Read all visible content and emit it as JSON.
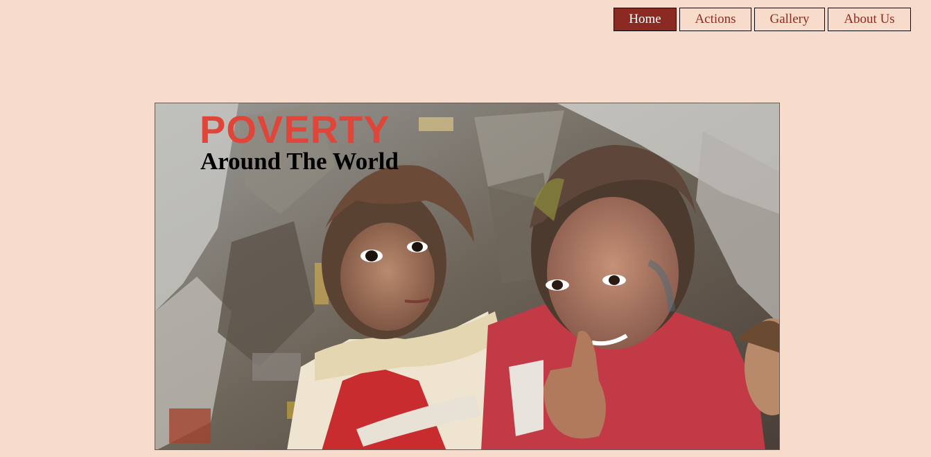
{
  "nav": {
    "items": [
      {
        "label": "Home",
        "active": true
      },
      {
        "label": "Actions",
        "active": false
      },
      {
        "label": "Gallery",
        "active": false
      },
      {
        "label": "About Us",
        "active": false
      }
    ]
  },
  "hero": {
    "title": "POVERTY",
    "subtitle": "Around The World",
    "image": "photo-of-two-children"
  },
  "colors": {
    "background": "#f8dccb",
    "nav_active_bg": "#8b2a22",
    "nav_text": "#8b2a1f",
    "title_red": "#e0453a"
  }
}
